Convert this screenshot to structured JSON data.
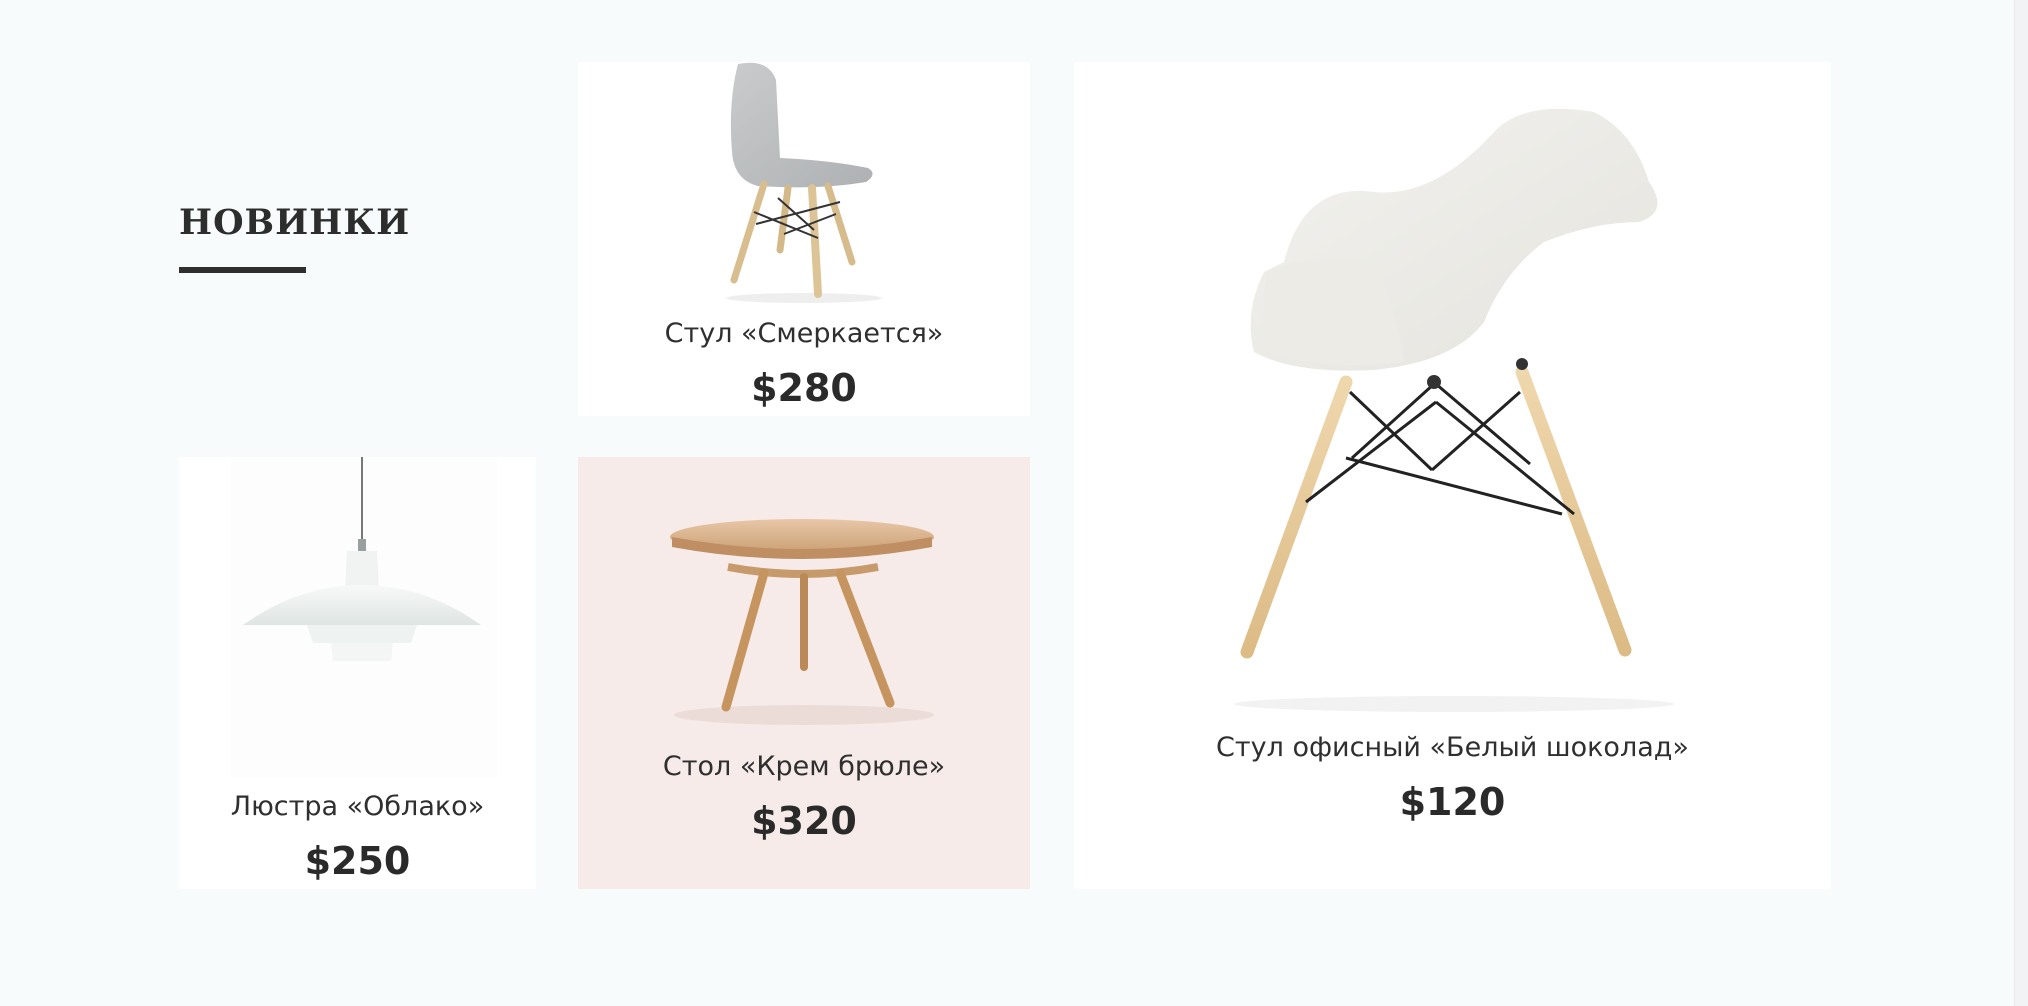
{
  "section": {
    "title": "НОВИНКИ"
  },
  "products": [
    {
      "name": "Стул «Смеркается»",
      "price": "$280",
      "icon": "chair-grey-icon"
    },
    {
      "name": "Стул офисный «Белый шоколад»",
      "price": "$120",
      "icon": "armchair-white-icon"
    },
    {
      "name": "Люстра «Облако»",
      "price": "$250",
      "icon": "pendant-lamp-icon"
    },
    {
      "name": "Стол «Крем брюле»",
      "price": "$320",
      "icon": "round-table-icon"
    }
  ],
  "colors": {
    "page_background": "#f8fbfc",
    "card_background": "#ffffff",
    "highlight_card_background": "#f6ebe9",
    "text": "#2b2b2b"
  }
}
